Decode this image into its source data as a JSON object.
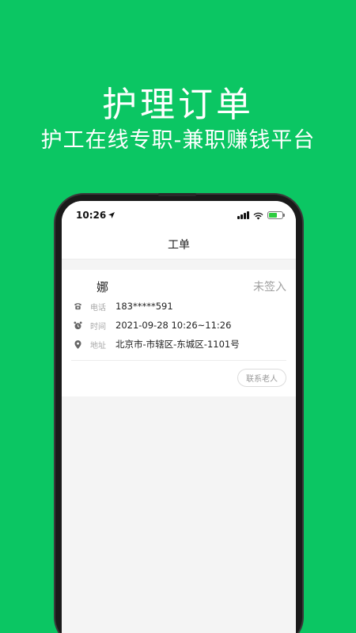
{
  "banner": {
    "title": "护理订单",
    "subtitle": "护工在线专职-兼职赚钱平台"
  },
  "statusbar": {
    "time": "10:26",
    "location_icon": "location-arrow-icon",
    "signal_icon": "cellular-signal-icon",
    "wifi_icon": "wifi-icon",
    "battery_icon": "battery-charging-icon"
  },
  "navbar": {
    "title": "工单"
  },
  "order": {
    "name": "娜",
    "status": "未签入",
    "phone_label": "电话",
    "phone": "183*****591",
    "time_label": "时间",
    "time": "2021-09-28 10:26~11:26",
    "address_label": "地址",
    "address": "北京市-市辖区-东城区-1101号",
    "contact_button": "联系老人"
  },
  "colors": {
    "background": "#0bc663",
    "status_text": "#a0a0a0"
  }
}
